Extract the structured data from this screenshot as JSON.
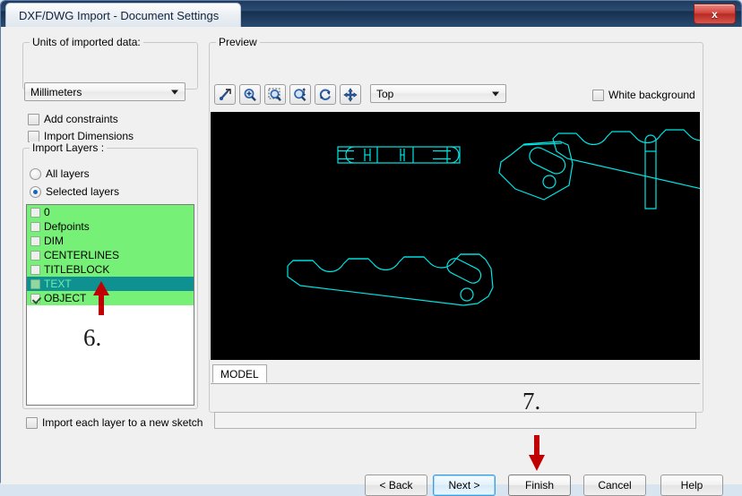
{
  "window": {
    "title": "DXF/DWG Import - Document Settings",
    "close_label": "x",
    "close_icon": "close-icon"
  },
  "left_panel": {
    "units_group_label": "Units of imported data:",
    "units_value": "Millimeters",
    "checkboxes": [
      {
        "label": "Add constraints",
        "checked": false
      },
      {
        "label": "Import Dimensions",
        "checked": false
      }
    ],
    "import_layers_group_label": "Import Layers :",
    "radios": [
      {
        "label": "All layers",
        "selected": false
      },
      {
        "label": "Selected layers",
        "selected": true
      }
    ],
    "layers": [
      {
        "name": "0",
        "checked": false,
        "selected": false
      },
      {
        "name": "Defpoints",
        "checked": false,
        "selected": false
      },
      {
        "name": "DIM",
        "checked": false,
        "selected": false
      },
      {
        "name": "CENTERLINES",
        "checked": false,
        "selected": false
      },
      {
        "name": "TITLEBLOCK",
        "checked": false,
        "selected": false
      },
      {
        "name": "TEXT",
        "checked": false,
        "selected": true
      },
      {
        "name": "OBJECT",
        "checked": true,
        "selected": false
      }
    ],
    "import_each_layer_label": "Import each layer to a new sketch",
    "import_each_layer_checked": false
  },
  "preview": {
    "group_label": "Preview",
    "toolbar": [
      {
        "icon": "zoom-to-selection-icon",
        "name": "zoom-to-selection-button"
      },
      {
        "icon": "zoom-in-icon",
        "name": "zoom-in-button"
      },
      {
        "icon": "zoom-to-area-icon",
        "name": "zoom-to-area-button"
      },
      {
        "icon": "zoom-to-fit-icon",
        "name": "zoom-to-fit-button"
      },
      {
        "icon": "rotate-icon",
        "name": "rotate-view-button"
      },
      {
        "icon": "pan-icon",
        "name": "pan-view-button"
      }
    ],
    "view_orientation": "Top",
    "white_background_label": "White background",
    "white_background_checked": false,
    "tab_label": "MODEL",
    "status_text": "",
    "canvas_background": "#000000",
    "drawing_color": "#00e5e5"
  },
  "footer": {
    "buttons": [
      {
        "label": "< Back",
        "state": "normal"
      },
      {
        "label": "Next >",
        "state": "focus"
      },
      {
        "label": "Finish",
        "state": "hot"
      },
      {
        "label": "Cancel",
        "state": "normal"
      },
      {
        "label": "Help",
        "state": "normal"
      }
    ]
  },
  "annotations": [
    {
      "number": "6.",
      "arrow": "up-arrow-icon",
      "color": "#c00000"
    },
    {
      "number": "7.",
      "arrow": "down-arrow-icon",
      "color": "#c00000"
    }
  ],
  "colors": {
    "layer_list_highlight": "#77f077",
    "layer_selected": "#109191",
    "annotation_red": "#c00000",
    "title_bar": "#1f3a5c"
  }
}
